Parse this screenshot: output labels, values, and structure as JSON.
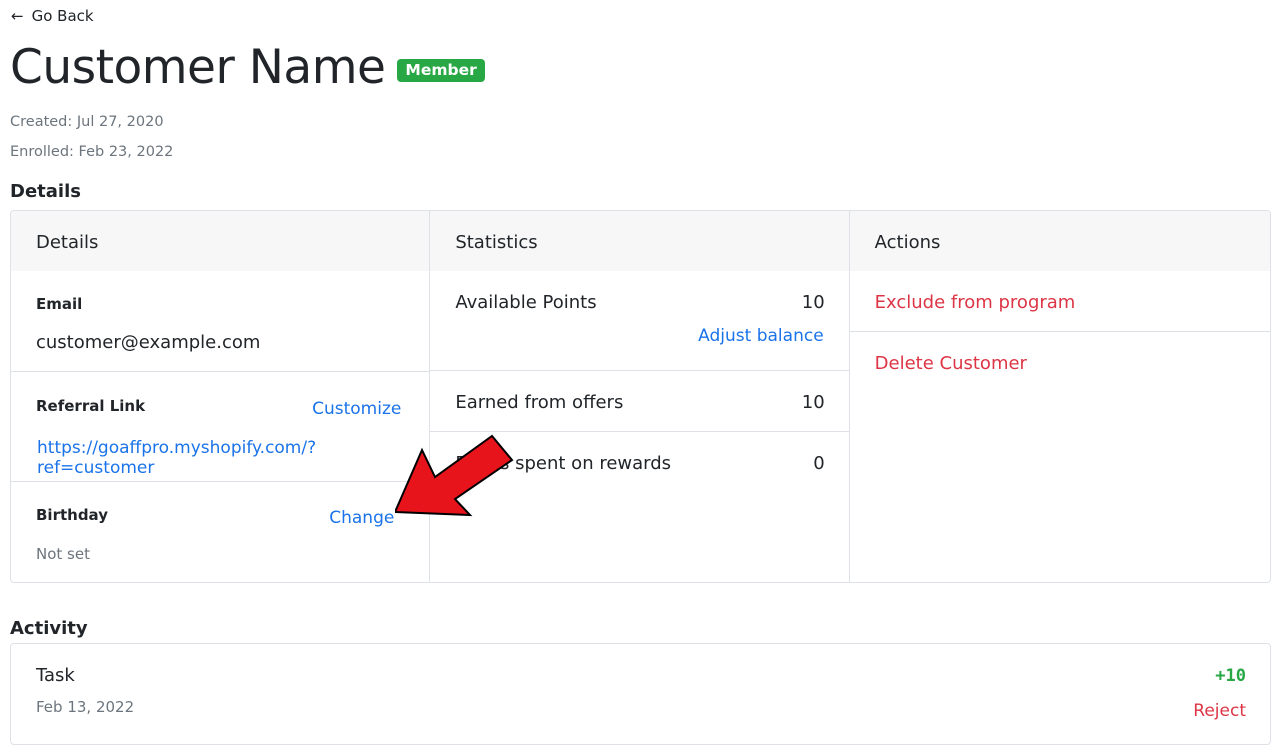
{
  "nav": {
    "back_label": "Go Back"
  },
  "header": {
    "title": "Customer Name",
    "badge": "Member",
    "created": "Created: Jul 27, 2020",
    "enrolled": "Enrolled: Feb 23, 2022"
  },
  "sections": {
    "details": "Details",
    "activity": "Activity"
  },
  "details": {
    "heading": "Details",
    "email_label": "Email",
    "email_value": "customer@example.com",
    "referral_label": "Referral Link",
    "referral_action": "Customize",
    "referral_url": "https://goaffpro.myshopify.com/?ref=customer",
    "birthday_label": "Birthday",
    "birthday_action": "Change",
    "birthday_value": "Not set"
  },
  "statistics": {
    "heading": "Statistics",
    "available_label": "Available Points",
    "available_value": "10",
    "adjust_label": "Adjust balance",
    "earned_label": "Earned from offers",
    "earned_value": "10",
    "spent_label": "Points spent on rewards",
    "spent_value": "0"
  },
  "actions": {
    "heading": "Actions",
    "exclude_label": "Exclude from program",
    "delete_label": "Delete Customer"
  },
  "activity": [
    {
      "task": "Task",
      "date": "Feb 13, 2022",
      "points": "+10",
      "action": "Reject"
    }
  ],
  "colors": {
    "badge": "#28a745",
    "link": "#1a73e8",
    "danger": "#dc3545",
    "header_bg": "#f7f7f7",
    "annotation_arrow": "#e8141c"
  },
  "icons": {
    "back": "arrow-left-icon",
    "annotation": "red-arrow-annotation"
  }
}
